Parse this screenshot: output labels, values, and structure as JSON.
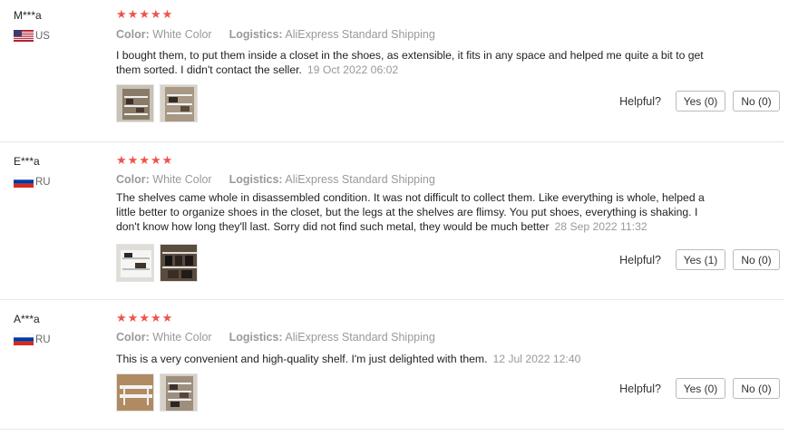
{
  "labels": {
    "color": "Color:",
    "logistics": "Logistics:",
    "helpful": "Helpful?"
  },
  "colors": {
    "star": "#f0524c",
    "muted": "#999999"
  },
  "reviews": [
    {
      "user": "M***a",
      "country": "US",
      "rating": 5,
      "color": "White Color",
      "logistics": "AliExpress Standard Shipping",
      "text": "I bought them, to put them inside a closet in the shoes, as extensible, it fits in any space and helped me quite a bit to get them sorted. I didn't contact the seller.",
      "date": "19 Oct 2022 06:02",
      "yes": "Yes (0)",
      "no": "No (0)"
    },
    {
      "user": "E***a",
      "country": "RU",
      "rating": 5,
      "color": "White Color",
      "logistics": "AliExpress Standard Shipping",
      "text": "The shelves came whole in disassembled condition. It was not difficult to collect them. Like everything is whole, helped a little better to organize shoes in the closet, but the legs at the shelves are flimsy. You put shoes, everything is shaking. I don't know how long they'll last. Sorry did not find such metal, they would be much better",
      "date": "28 Sep 2022 11:32",
      "yes": "Yes (1)",
      "no": "No (0)"
    },
    {
      "user": "A***a",
      "country": "RU",
      "rating": 5,
      "color": "White Color",
      "logistics": "AliExpress Standard Shipping",
      "text": "This is a very convenient and high-quality shelf. I'm just delighted with them.",
      "date": "12 Jul 2022 12:40",
      "yes": "Yes (0)",
      "no": "No (0)"
    }
  ]
}
